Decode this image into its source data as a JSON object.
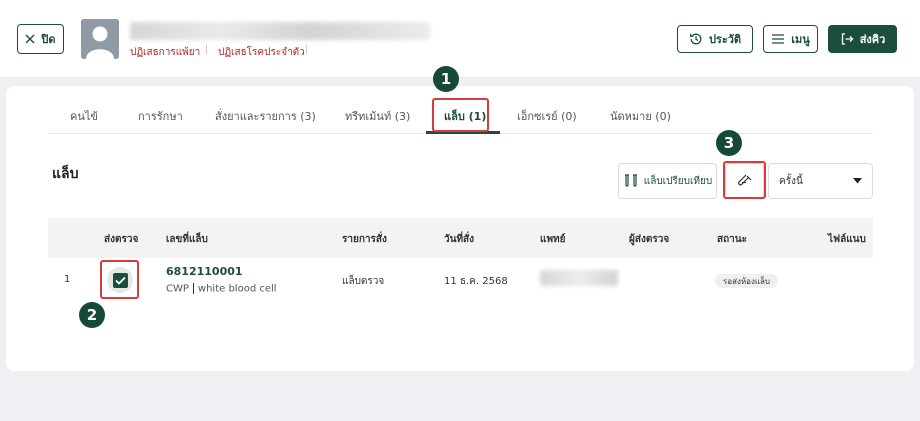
{
  "header": {
    "close_label": "ปิด",
    "allergy_label": "ปฏิเสธการแพ้ยา",
    "disease_label": "ปฏิเสธโรคประจำตัว",
    "history_label": "ประวัติ",
    "menu_label": "เมนู",
    "send_label": "ส่งคิว"
  },
  "tabs": [
    {
      "label": "คนไข้"
    },
    {
      "label": "การรักษา"
    },
    {
      "label": "สั่งยาและรายการ (3)"
    },
    {
      "label": "ทรีทเม้นท์ (3)"
    },
    {
      "label": "แล็บ (1)",
      "active": true
    },
    {
      "label": "เอ็กซเรย์ (0)"
    },
    {
      "label": "นัดหมาย (0)"
    }
  ],
  "markers": [
    "1",
    "2",
    "3"
  ],
  "lab": {
    "title": "แล็บ",
    "compare_label": "แล็บเปรียบเทียบ",
    "filter_value": "ครั้งนี้"
  },
  "table": {
    "columns": [
      "ส่งตรวจ",
      "เลขที่แล็บ",
      "รายการสั่ง",
      "วันที่สั่ง",
      "แพทย์",
      "ผู้ส่งตรวจ",
      "สถานะ",
      "ไฟล์แนบ"
    ],
    "rows": [
      {
        "index": "1",
        "checked": true,
        "lab_no": "6812110001",
        "lab_code": "CWP",
        "lab_desc": "white blood cell",
        "order": "แล็บตรวจ",
        "date": "11 ธ.ค. 2568",
        "status": "รอส่งห้องแล็บ"
      }
    ]
  },
  "colors": {
    "primary": "#1d4d3c",
    "allergy": "#b3261e",
    "highlight": "#d93a3a"
  }
}
